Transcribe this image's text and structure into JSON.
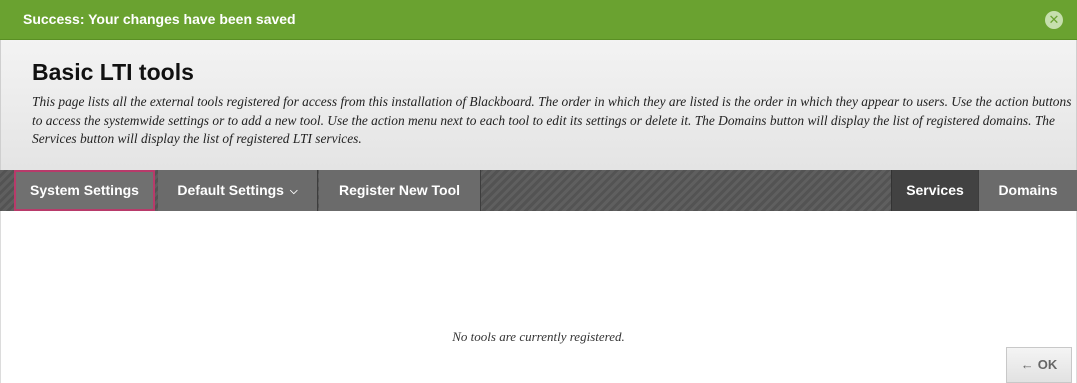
{
  "banner": {
    "message": "Success: Your changes have been saved",
    "close_icon": "close-icon"
  },
  "header": {
    "title": "Basic LTI tools",
    "description": "This page lists all the external tools registered for access from this installation of Blackboard. The order in which they are listed is the order in which they appear to users. Use the action buttons to access the systemwide settings or to add a new tool. Use the action menu next to each tool to edit its settings or delete it. The Domains button will display the list of registered domains. The Services button will display the list of registered LTI services."
  },
  "actionbar": {
    "system_settings": "System Settings",
    "default_settings": "Default Settings",
    "register_new_tool": "Register New Tool",
    "services": "Services",
    "domains": "Domains"
  },
  "content": {
    "empty_message": "No tools are currently registered."
  },
  "footer": {
    "ok_label": "OK"
  },
  "colors": {
    "success_green": "#6aa230",
    "actionbar_gray": "#5a5a5a",
    "focus_outline": "#b83a6a"
  }
}
